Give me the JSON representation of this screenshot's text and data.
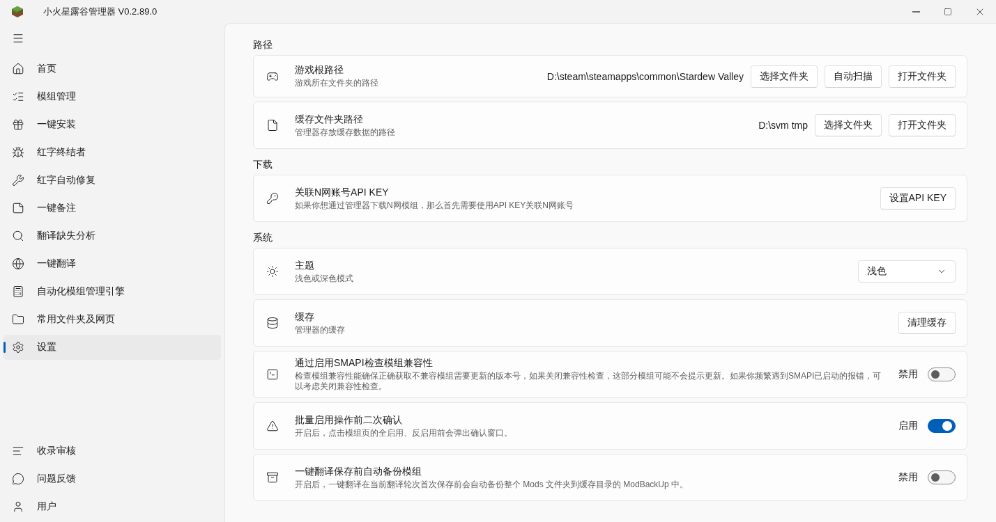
{
  "window": {
    "title": "小火星露谷管理器 V0.2.89.0"
  },
  "sidebar": {
    "items": [
      {
        "label": "首页",
        "selected": false
      },
      {
        "label": "模组管理",
        "selected": false
      },
      {
        "label": "一键安装",
        "selected": false
      },
      {
        "label": "红字终结者",
        "selected": false
      },
      {
        "label": "红字自动修复",
        "selected": false
      },
      {
        "label": "一键备注",
        "selected": false
      },
      {
        "label": "翻译缺失分析",
        "selected": false
      },
      {
        "label": "一键翻译",
        "selected": false
      },
      {
        "label": "自动化模组管理引擎",
        "selected": false
      },
      {
        "label": "常用文件夹及网页",
        "selected": false
      },
      {
        "label": "设置",
        "selected": true
      }
    ],
    "footer_items": [
      {
        "label": "收录审核",
        "selected": false
      },
      {
        "label": "问题反馈",
        "selected": false
      },
      {
        "label": "用户",
        "selected": false
      }
    ]
  },
  "sections": [
    {
      "title": "路径",
      "cards": [
        {
          "kind": "buttons",
          "title": "游戏根路径",
          "subtitle": "游戏所在文件夹的路径",
          "value": "D:\\steam\\steamapps\\common\\Stardew Valley",
          "buttons": [
            "选择文件夹",
            "自动扫描",
            "打开文件夹"
          ]
        },
        {
          "kind": "buttons",
          "title": "缓存文件夹路径",
          "subtitle": "管理器存放缓存数据的路径",
          "value": "D:\\svm tmp",
          "buttons": [
            "选择文件夹",
            "打开文件夹"
          ]
        }
      ]
    },
    {
      "title": "下载",
      "cards": [
        {
          "kind": "buttons",
          "title": "关联N网账号API KEY",
          "subtitle": "如果你想通过管理器下载N网模组，那么首先需要使用API KEY关联N网账号",
          "buttons": [
            "设置API KEY"
          ]
        }
      ]
    },
    {
      "title": "系统",
      "cards": [
        {
          "kind": "dropdown",
          "title": "主题",
          "subtitle": "浅色或深色模式",
          "selection": "浅色"
        },
        {
          "kind": "buttons",
          "title": "缓存",
          "subtitle": "管理器的缓存",
          "buttons": [
            "清理缓存"
          ]
        },
        {
          "kind": "toggle",
          "title": "通过启用SMAPI检查模组兼容性",
          "subtitle": "检查模组兼容性能确保正确获取不兼容模组需要更新的版本号，如果关闭兼容性检查，这部分模组可能不会提示更新。如果你频繁遇到SMAPI已启动的报错，可以考虑关闭兼容性检查。",
          "state_label": "禁用",
          "on": false
        },
        {
          "kind": "toggle",
          "title": "批量启用操作前二次确认",
          "subtitle": "开启后，点击模组页的全启用、反启用前会弹出确认窗口。",
          "state_label": "启用",
          "on": true
        },
        {
          "kind": "toggle",
          "title": "一键翻译保存前自动备份模组",
          "subtitle": "开启后，一键翻译在当前翻译轮次首次保存前会自动备份整个 Mods 文件夹到缓存目录的 ModBackUp 中。",
          "state_label": "禁用",
          "on": false
        }
      ]
    }
  ]
}
